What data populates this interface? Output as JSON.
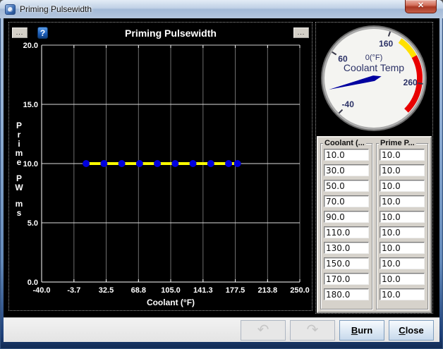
{
  "window": {
    "title": "Priming Pulsewidth",
    "close_glyph": "✕"
  },
  "chart": {
    "menu_left_label": "...",
    "menu_right_label": "...",
    "help_label": "?"
  },
  "chart_data": {
    "type": "line",
    "title": "Priming Pulsewidth",
    "xlabel": "Coolant (°F)",
    "ylabel": "Prime PW ms",
    "xlim": [
      -40,
      250
    ],
    "ylim": [
      0,
      20
    ],
    "x_tick_labels": [
      "-40.0",
      "-3.7",
      "32.5",
      "68.8",
      "105.0",
      "141.3",
      "177.5",
      "213.8",
      "250.0"
    ],
    "y_tick_labels": [
      "0.0",
      "5.0",
      "10.0",
      "15.0",
      "20.0"
    ],
    "x": [
      10,
      30,
      50,
      70,
      90,
      110,
      130,
      150,
      170,
      180
    ],
    "y": [
      10,
      10,
      10,
      10,
      10,
      10,
      10,
      10,
      10,
      10
    ],
    "grid": true,
    "line_color": "#ffff00",
    "point_color": "#0000dd",
    "background": "#000000",
    "vgrid_color": "#6f6f6f",
    "hgrid_color": "#dcdcdc",
    "text_color": "#ffffff"
  },
  "gauge": {
    "title": "Coolant Temp",
    "value_label": "0(°F)",
    "value": 0,
    "min": -40,
    "max": 310,
    "start_angle": 225,
    "sweep": 270,
    "tick_labels": [
      "-40",
      "60",
      "160",
      "260"
    ],
    "tick_values": [
      -40,
      60,
      160,
      260
    ],
    "warn_zone": [
      180,
      215
    ],
    "danger_zone": [
      215,
      310
    ],
    "warn_color": "#ffe000",
    "danger_color": "#e80000",
    "needle_color": "#0000a0",
    "label_color": "#2b3166",
    "face_color": "#f4f4f1"
  },
  "table": {
    "columns": [
      {
        "header": "Coolant (...",
        "values": [
          "10.0",
          "30.0",
          "50.0",
          "70.0",
          "90.0",
          "110.0",
          "130.0",
          "150.0",
          "170.0",
          "180.0"
        ]
      },
      {
        "header": "Prime P...",
        "values": [
          "10.0",
          "10.0",
          "10.0",
          "10.0",
          "10.0",
          "10.0",
          "10.0",
          "10.0",
          "10.0",
          "10.0"
        ]
      }
    ]
  },
  "footer": {
    "undo_glyph": "↶",
    "redo_glyph": "↷",
    "burn_label": "Burn",
    "close_label": "Close"
  }
}
